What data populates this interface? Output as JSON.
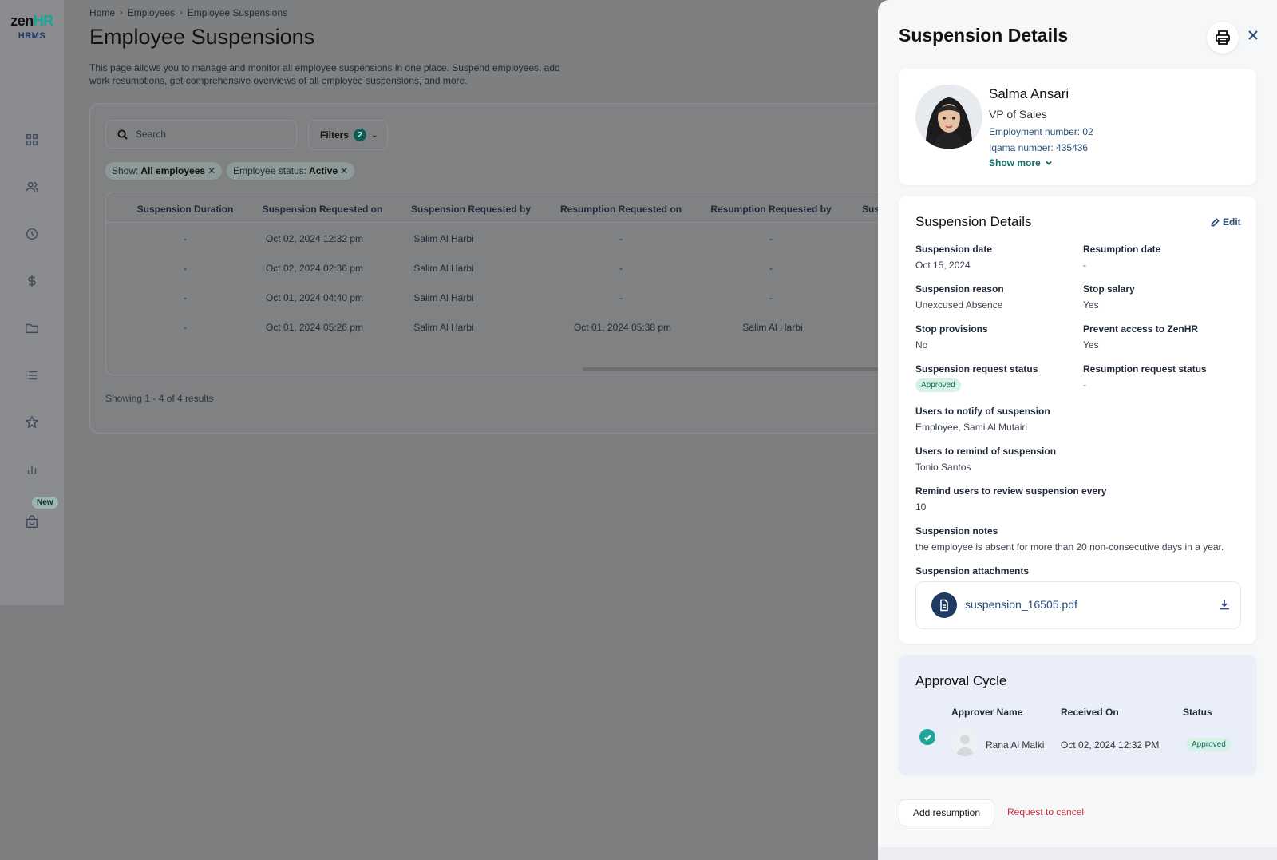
{
  "app": {
    "logo_main_a": "zen",
    "logo_main_b": "HR",
    "logo_sub": "HRMS"
  },
  "sidebar": {
    "icons": [
      "dashboard-icon",
      "people-icon",
      "clock-icon",
      "dollar-icon",
      "folder-icon",
      "list-icon",
      "star-icon",
      "bar-chart-icon",
      "bag-icon"
    ],
    "new_badge": "New"
  },
  "breadcrumb": {
    "items": [
      "Home",
      "Employees",
      "Employee Suspensions"
    ]
  },
  "page": {
    "title": "Employee Suspensions",
    "description": "This page allows you to manage and monitor all employee suspensions in one place. Suspend employees, add work resumptions, get comprehensive overviews of all employee suspensions, and more."
  },
  "toolbar": {
    "search_placeholder": "Search",
    "filters_label": "Filters",
    "filters_count": "2",
    "chips": [
      {
        "key": "Show:",
        "value": "All employees"
      },
      {
        "key": "Employee status:",
        "value": "Active"
      }
    ]
  },
  "table": {
    "headers": [
      "Suspension Duration",
      "Suspension Requested on",
      "Suspension Requested by",
      "Resumption Requested on",
      "Resumption Requested by",
      "Sus"
    ],
    "rows": [
      [
        "-",
        "Oct 02, 2024 12:32 pm",
        "Salim Al Harbi",
        "-",
        "-"
      ],
      [
        "-",
        "Oct 02, 2024 02:36 pm",
        "Salim Al Harbi",
        "-",
        "-"
      ],
      [
        "-",
        "Oct 01, 2024 04:40 pm",
        "Salim Al Harbi",
        "-",
        "-"
      ],
      [
        "-",
        "Oct 01, 2024 05:26 pm",
        "Salim Al Harbi",
        "Oct 01, 2024 05:38 pm",
        "Salim Al Harbi"
      ]
    ],
    "showing": "Showing 1 - 4 of 4 results"
  },
  "drawer": {
    "title": "Suspension Details",
    "employee": {
      "name": "Salma Ansari",
      "job_title": "VP of Sales",
      "employment_number": "Employment number: 02",
      "iqama_number": "Iqama number: 435436",
      "show_more": "Show more"
    },
    "details": {
      "title": "Suspension Details",
      "edit_label": "Edit",
      "fields": {
        "suspension_date": {
          "label": "Suspension date",
          "value": "Oct 15, 2024"
        },
        "resumption_date": {
          "label": "Resumption date",
          "value": "-"
        },
        "suspension_reason": {
          "label": "Suspension reason",
          "value": "Unexcused Absence"
        },
        "stop_salary": {
          "label": "Stop salary",
          "value": "Yes"
        },
        "stop_provisions": {
          "label": "Stop provisions",
          "value": "No"
        },
        "prevent_access": {
          "label": "Prevent access to ZenHR",
          "value": "Yes"
        },
        "suspension_request_status": {
          "label": "Suspension request status",
          "value": "Approved"
        },
        "resumption_request_status": {
          "label": "Resumption request status",
          "value": "-"
        },
        "users_notify": {
          "label": "Users to notify of suspension",
          "value": "Employee, Sami Al Mutairi"
        },
        "users_remind": {
          "label": "Users to remind of suspension",
          "value": "Tonio Santos"
        },
        "remind_every": {
          "label": "Remind users to review suspension every",
          "value": "10"
        },
        "notes": {
          "label": "Suspension notes",
          "value": "the employee is absent for more than 20 non-consecutive days in a year."
        },
        "attachments": {
          "label": "Suspension attachments",
          "file_name": "suspension_16505.pdf"
        }
      }
    },
    "approval": {
      "title": "Approval Cycle",
      "headers": [
        "Approver Name",
        "Received On",
        "Status"
      ],
      "row": {
        "name": "Rana Al Malki",
        "received_on": "Oct 02, 2024 12:32 PM",
        "status": "Approved"
      }
    },
    "actions": {
      "add_resumption": "Add resumption",
      "request_cancel": "Request to cancel"
    }
  },
  "colors": {
    "accent": "#12a89a",
    "brand_navy": "#1f3a63",
    "approved_bg": "#d6f2e6",
    "danger": "#d22a3c"
  }
}
